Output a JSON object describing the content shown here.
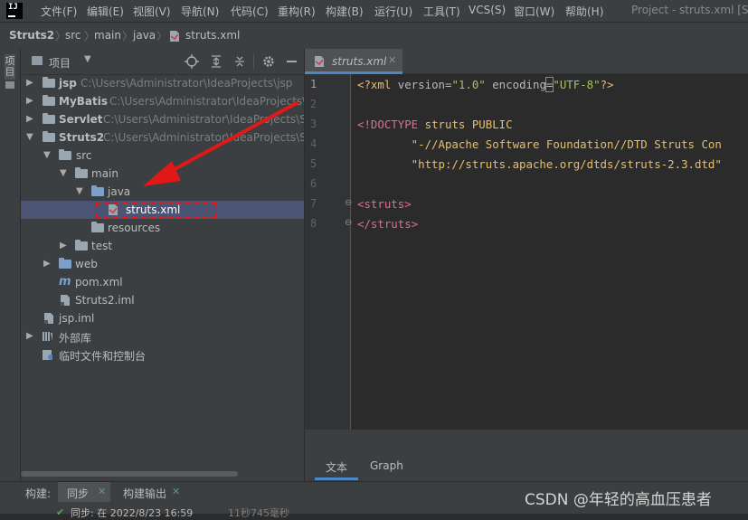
{
  "app": {
    "logo_text": "IJ"
  },
  "menu": [
    "文件(F)",
    "编辑(E)",
    "视图(V)",
    "导航(N)",
    "代码(C)",
    "重构(R)",
    "构建(B)",
    "运行(U)",
    "工具(T)",
    "VCS(S)",
    "窗口(W)",
    "帮助(H)"
  ],
  "window_title": "Project - struts.xml [St",
  "breadcrumb": [
    "Struts2",
    "src",
    "main",
    "java",
    "struts.xml"
  ],
  "left_stripe": {
    "tab_label": "项目"
  },
  "project_panel": {
    "title": "项目",
    "tree": [
      {
        "label": "jsp",
        "path": "C:\\Users\\Administrator\\IdeaProjects\\jsp",
        "bold": true,
        "level": 0,
        "arrow": "collapsed",
        "icon": "module-folder-icon"
      },
      {
        "label": "MyBatis",
        "path": "C:\\Users\\Administrator\\IdeaProjects\\",
        "bold": true,
        "level": 0,
        "arrow": "collapsed",
        "icon": "module-folder-icon"
      },
      {
        "label": "Servlet",
        "path": "C:\\Users\\Administrator\\IdeaProjects\\S",
        "bold": true,
        "level": 0,
        "arrow": "collapsed",
        "icon": "module-folder-icon"
      },
      {
        "label": "Struts2",
        "path": "C:\\Users\\Administrator\\IdeaProjects\\S",
        "bold": true,
        "level": 0,
        "arrow": "expanded",
        "icon": "module-folder-icon"
      },
      {
        "label": "src",
        "path": "",
        "bold": false,
        "level": 1,
        "arrow": "expanded",
        "icon": "folder-icon"
      },
      {
        "label": "main",
        "path": "",
        "bold": false,
        "level": 2,
        "arrow": "expanded",
        "icon": "folder-icon"
      },
      {
        "label": "java",
        "path": "",
        "bold": false,
        "level": 3,
        "arrow": "expanded",
        "icon": "source-folder-icon"
      },
      {
        "label": "struts.xml",
        "path": "",
        "bold": false,
        "level": 4,
        "arrow": "none",
        "icon": "xml-file-icon",
        "selected": true
      },
      {
        "label": "resources",
        "path": "",
        "bold": false,
        "level": 4,
        "arrow": "none",
        "icon": "resources-folder-icon"
      },
      {
        "label": "test",
        "path": "",
        "bold": false,
        "level": 2,
        "arrow": "collapsed",
        "icon": "folder-icon"
      },
      {
        "label": "web",
        "path": "",
        "bold": false,
        "level": 1,
        "arrow": "collapsed",
        "icon": "web-folder-icon"
      },
      {
        "label": "pom.xml",
        "path": "",
        "bold": false,
        "level": 1,
        "arrow": "none",
        "icon": "maven-icon"
      },
      {
        "label": "Struts2.iml",
        "path": "",
        "bold": false,
        "level": 1,
        "arrow": "none",
        "icon": "iml-file-icon"
      },
      {
        "label": "jsp.iml",
        "path": "",
        "bold": false,
        "level": 0,
        "arrow": "none",
        "icon": "iml-file-icon"
      },
      {
        "label": "外部库",
        "path": "",
        "bold": false,
        "level": 0,
        "arrow": "collapsed",
        "icon": "library-icon"
      },
      {
        "label": "临时文件和控制台",
        "path": "",
        "bold": false,
        "level": 0,
        "arrow": "none",
        "icon": "scratch-icon"
      }
    ]
  },
  "editor": {
    "tab_label": "struts.xml",
    "line_numbers": [
      "1",
      "2",
      "3",
      "4",
      "5",
      "6",
      "7",
      "8"
    ],
    "code": {
      "l1_a": "<?xml ",
      "l1_b": "version",
      "l1_c": "=",
      "l1_d": "\"1.0\"",
      "l1_e": " encoding",
      "l1_f": "=",
      "l1_g": "\"UTF-8\"",
      "l1_h": "?>",
      "l3_a": "<!DOCTYPE ",
      "l3_b": "struts ",
      "l3_c": "PUBLIC",
      "l4": "        \"-//Apache Software Foundation//DTD Struts Con",
      "l5": "        \"http://struts.apache.org/dtds/struts-2.3.dtd\"",
      "l7": "<struts>",
      "l8": "</struts>"
    },
    "bottom_tabs": [
      "文本",
      "Graph"
    ]
  },
  "build_bar": {
    "label": "构建:",
    "tab_sync": "同步",
    "tab_output": "构建输出",
    "status": "同步: 在 2022/8/23 16:59",
    "timing": "11秒745毫秒"
  },
  "watermark": "CSDN @年轻的高血压患者",
  "colors": {
    "accent": "#4a88c7",
    "selection": "#4b5472",
    "annotation_red": "#e01818"
  }
}
